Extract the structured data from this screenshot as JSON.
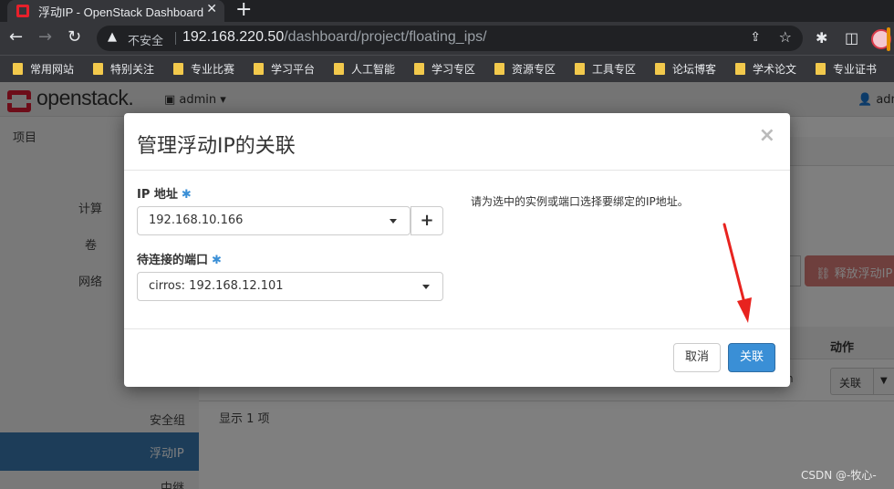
{
  "browser": {
    "tab_title": "浮动IP - OpenStack Dashboard",
    "tab_close": "✕",
    "new_tab": "+",
    "security_label": "不安全",
    "url_host": "192.168.220.50",
    "url_path": "/dashboard/project/floating_ips/",
    "bookmarks": [
      "常用网站",
      "特别关注",
      "专业比赛",
      "学习平台",
      "人工智能",
      "学习专区",
      "资源专区",
      "工具专区",
      "论坛博客",
      "学术论文",
      "专业证书"
    ]
  },
  "app": {
    "logo_text": "openstack.",
    "project_menu": "admin ▾",
    "user_menu": "adm",
    "sidebar": {
      "project": "项目",
      "compute": "计算",
      "volume": "卷",
      "network": "网络",
      "security_group": "安全组",
      "floating_ip": "浮动IP",
      "relay": "中继"
    },
    "content": {
      "release_button": "释放浮动IP",
      "actions_header": "动作",
      "row_clip": "n",
      "row_action": "关联",
      "showing": "显示 1 项"
    }
  },
  "modal": {
    "title": "管理浮动IP的关联",
    "close": "×",
    "ip_label": "IP 地址",
    "ip_value": "192.168.10.166",
    "add_label": "+",
    "port_label": "待连接的端口",
    "port_value": "cirros: 192.168.12.101",
    "required_mark": "✱",
    "help": "请为选中的实例或端口选择要绑定的IP地址。",
    "cancel": "取消",
    "associate": "关联"
  },
  "watermark": "CSDN @-牧心-",
  "colors": {
    "primary": "#3a8fd6",
    "danger_disabled": "#dc7f7a",
    "sidebar_active": "#3a7ab3",
    "annotation_arrow": "#e8231f"
  }
}
